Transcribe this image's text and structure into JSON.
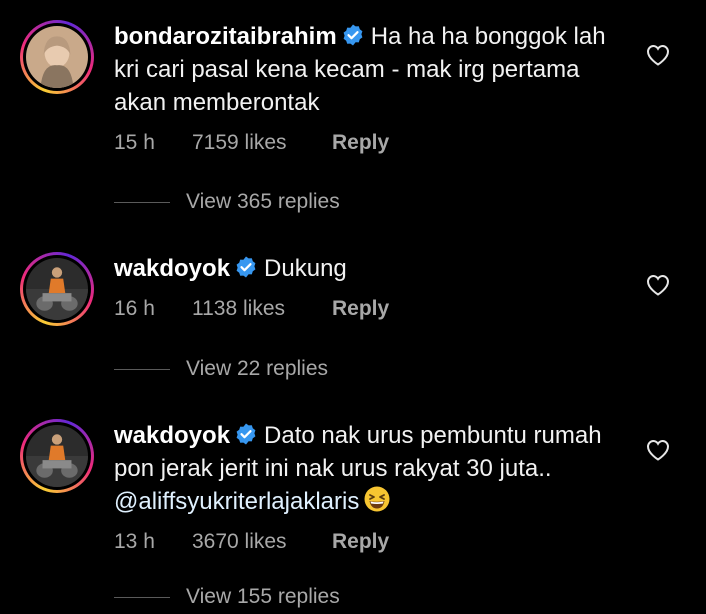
{
  "comments": [
    {
      "username": "bondarozitaibrahim",
      "text": "Ha ha ha bonggok lah kri cari pasal kena kecam - mak irg pertama akan memberontak",
      "time": "15 h",
      "likes": "7159 likes",
      "reply": "Reply",
      "view_replies": "View 365 replies"
    },
    {
      "username": "wakdoyok",
      "text": "Dukung",
      "time": "16 h",
      "likes": "1138 likes",
      "reply": "Reply",
      "view_replies": "View 22 replies"
    },
    {
      "username": "wakdoyok",
      "text_before": "Dato nak urus pembuntu rumah pon jerak jerit ini nak urus rakyat 30 juta.. ",
      "mention": "@aliffsyukriterlajaklaris",
      "time": "13 h",
      "likes": "3670 likes",
      "reply": "Reply",
      "view_replies": "View 155 replies"
    }
  ],
  "colors": {
    "background": "#000000",
    "text": "#f2f2f2",
    "secondary": "#a8a8a8",
    "verified": "#3797f0"
  },
  "icons": [
    "verified-badge-icon",
    "heart-icon",
    "grinning-squinting-face-emoji"
  ]
}
